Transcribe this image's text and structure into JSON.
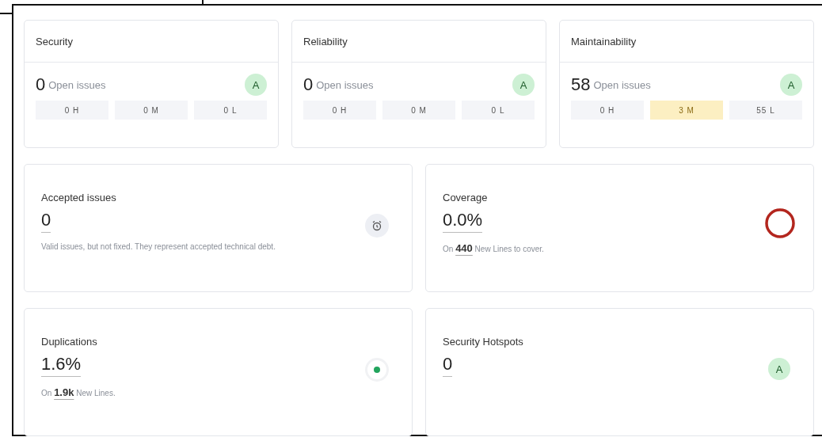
{
  "ratings": [
    {
      "title": "Security",
      "count": "0",
      "count_label": "Open issues",
      "grade": "A",
      "severities": [
        {
          "label": "0 H",
          "highlighted": false
        },
        {
          "label": "0 M",
          "highlighted": false
        },
        {
          "label": "0 L",
          "highlighted": false
        }
      ]
    },
    {
      "title": "Reliability",
      "count": "0",
      "count_label": "Open issues",
      "grade": "A",
      "severities": [
        {
          "label": "0 H",
          "highlighted": false
        },
        {
          "label": "0 M",
          "highlighted": false
        },
        {
          "label": "0 L",
          "highlighted": false
        }
      ]
    },
    {
      "title": "Maintainability",
      "count": "58",
      "count_label": "Open issues",
      "grade": "A",
      "severities": [
        {
          "label": "0 H",
          "highlighted": false
        },
        {
          "label": "3 M",
          "highlighted": true
        },
        {
          "label": "55 L",
          "highlighted": false
        }
      ]
    }
  ],
  "metrics": [
    {
      "title": "Accepted issues",
      "value": "0",
      "indicator": {
        "kind": "clock"
      },
      "note": "Valid issues, but not fixed. They represent accepted technical debt."
    },
    {
      "title": "Coverage",
      "value": "0.0%",
      "indicator": {
        "kind": "ring"
      },
      "note": "On **440** New Lines to cover."
    },
    {
      "title": "Duplications",
      "value": "1.6%",
      "indicator": {
        "kind": "dot"
      },
      "note": "On **1.9k** New Lines."
    },
    {
      "title": "Security Hotspots",
      "value": "0",
      "indicator": {
        "kind": "grade",
        "grade": "A"
      }
    }
  ]
}
